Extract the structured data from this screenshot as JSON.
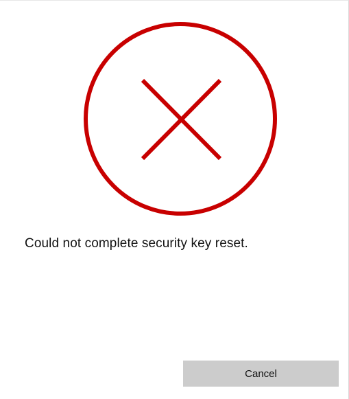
{
  "dialog": {
    "status_icon": "error-x-circle-icon",
    "message": "Could not complete security key reset.",
    "cancel_label": "Cancel"
  },
  "colors": {
    "error_red": "#c80000",
    "button_bg": "#cccccc",
    "background": "#ffffff"
  }
}
